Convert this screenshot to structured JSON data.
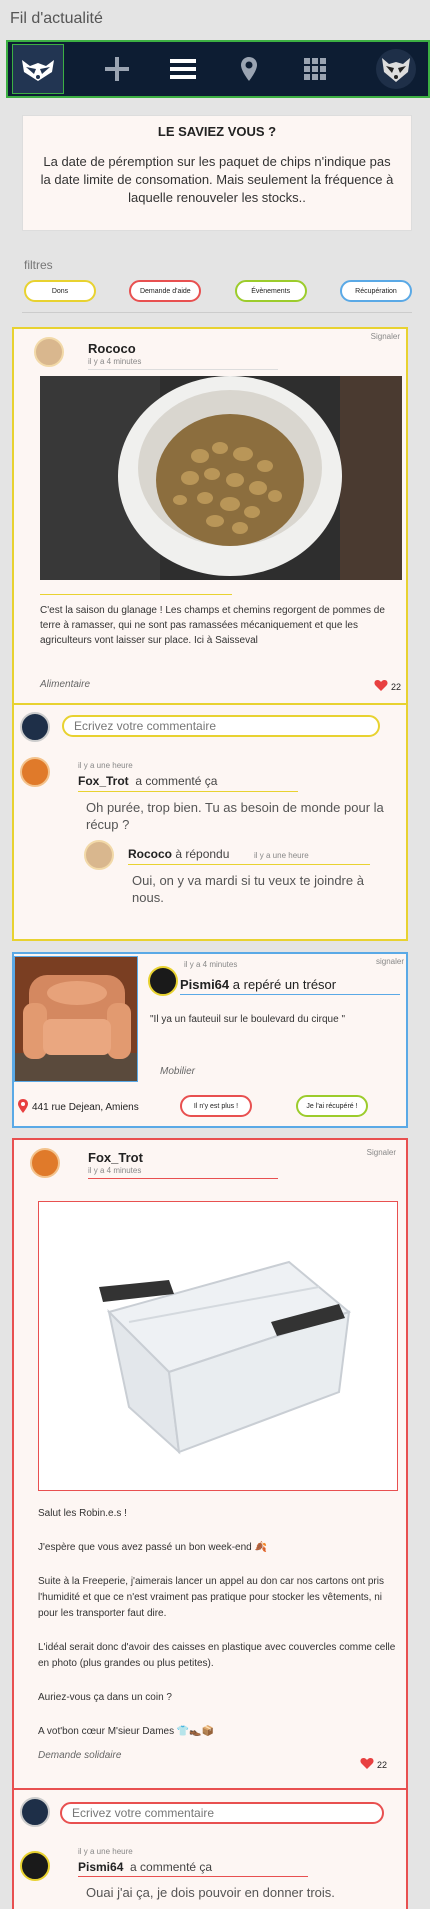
{
  "page": {
    "title": "Fil d'actualité"
  },
  "nav": {
    "logo_icon": "raccoon-logo-icon",
    "items": [
      {
        "name": "add-icon"
      },
      {
        "name": "menu-icon"
      },
      {
        "name": "map-pin-icon"
      },
      {
        "name": "grid-icon"
      }
    ],
    "avatar_icon": "raccoon-avatar-icon"
  },
  "info": {
    "title": "LE SAVIEZ VOUS ?",
    "text": "La date de péremption sur les paquet de chips n'indique pas la date limite de consomation. Mais seulement la fréquence à laquelle renouveler les stocks.."
  },
  "filters": {
    "label": "filtres",
    "items": [
      {
        "label": "Dons",
        "color": "#e8d230"
      },
      {
        "label": "Demande d'aide",
        "color": "#e85050"
      },
      {
        "label": "Évènements",
        "color": "#9ccc2c"
      },
      {
        "label": "Récupération",
        "color": "#5aa9e6"
      }
    ]
  },
  "post1": {
    "author": "Rococo",
    "time": "il y a 4 minutes",
    "report": "Signaler",
    "text": "C'est la saison du glanage ! Les champs et chemins regorgent de pommes de terre à ramasser, qui ne sont pas ramassées mécaniquement et que les agriculteurs vont laisser sur place. Ici à Saisseval",
    "category": "Alimentaire",
    "likes": "22",
    "comment_placeholder": "Ecrivez votre commentaire",
    "comments": [
      {
        "time": "il y a une heure",
        "author": "Fox_Trot",
        "action": "a commenté ça",
        "text": "Oh purée, trop bien. Tu as besoin de monde pour la récup ?"
      },
      {
        "time": "il y a une heure",
        "author": "Rococo",
        "action": "à répondu",
        "text": "Oui, on y va mardi si tu veux te joindre à nous."
      }
    ]
  },
  "treasure": {
    "time": "il y a 4 minutes",
    "author": "Pismi64",
    "action": "a repéré un trésor",
    "report": "signaler",
    "quote": "\"Il ya un fauteuil sur le boulevard du cirque \"",
    "category": "Mobilier",
    "address": "441 rue Dejean, Amiens",
    "btn_gone": "Il n'y est plus !",
    "btn_got": "Je l'ai récupéré !"
  },
  "post2": {
    "author": "Fox_Trot",
    "time": "il y a 4 minutes",
    "report": "Signaler",
    "paragraphs": [
      "Salut les Robin.e.s !",
      "J'espère que vous avez passé un bon week-end 🍂",
      "Suite à la Freeperie, j'aimerais lancer un appel au don car nos cartons ont pris l'humidité et que ce n'est vraiment pas pratique pour stocker les vêtements, ni pour les transporter faut dire.",
      "L'idéal serait donc d'avoir des caisses en plastique avec couvercles comme celle en photo (plus grandes ou plus petites).",
      "Auriez-vous ça dans un coin ?",
      "A vot'bon cœur M'sieur Dames 👕👞📦"
    ],
    "category": "Demande solidaire",
    "likes": "22",
    "comment_placeholder": "Ecrivez votre commentaire",
    "comment": {
      "time": "il y a une heure",
      "author": "Pismi64",
      "action": "a commenté ça",
      "text": "Ouai j'ai ça, je dois pouvoir en donner trois."
    }
  },
  "colors": {
    "yellow": "#e8d230",
    "red": "#e85050",
    "blue": "#5aa9e6",
    "green": "#9ccc2c",
    "nav": "#0d1d33"
  }
}
